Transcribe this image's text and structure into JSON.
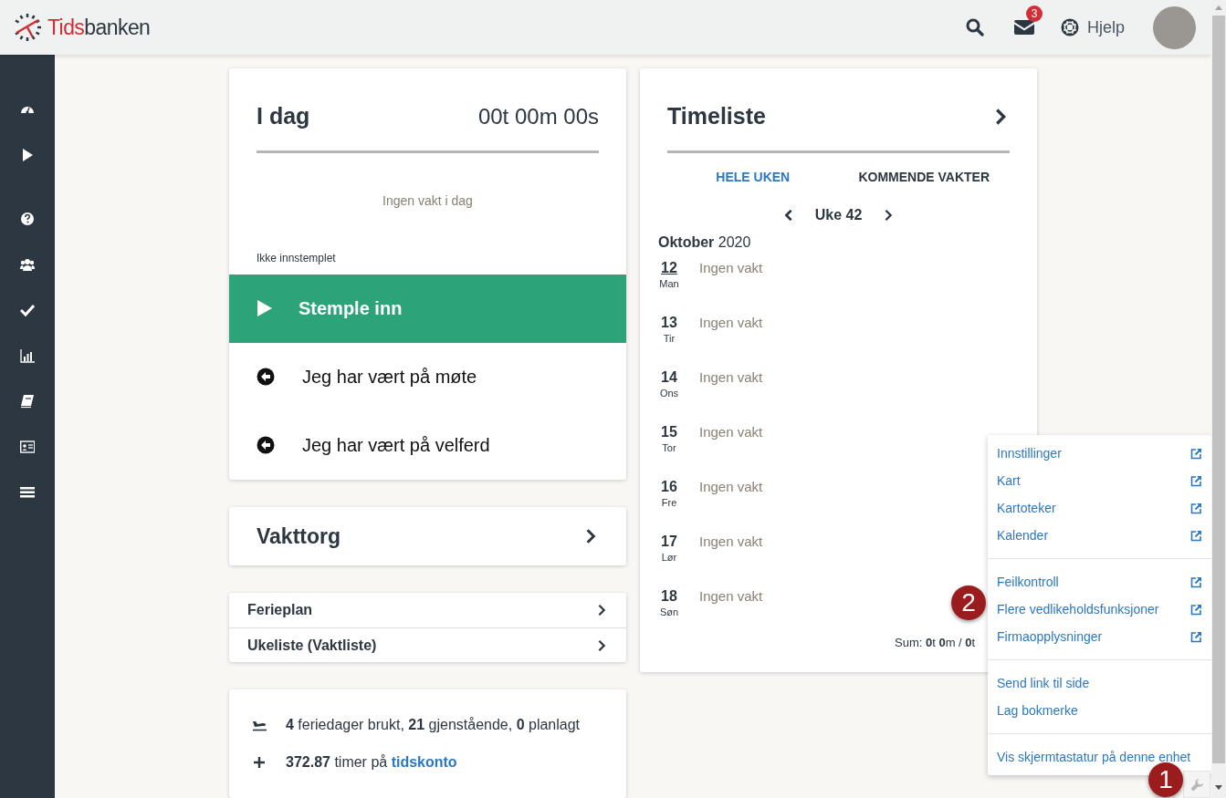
{
  "header": {
    "logo": {
      "prefix": "Tids",
      "suffix": "banken"
    },
    "messages_badge": "3",
    "help_label": "Hjelp"
  },
  "today": {
    "title": "I dag",
    "timer": "00t 00m 00s",
    "no_shift": "Ingen vakt i dag",
    "status": "Ikke innstemplet",
    "clock_in": "Stemple inn",
    "actions": [
      "Jeg har vært på møte",
      "Jeg har vært på velferd"
    ]
  },
  "shift_market": {
    "title": "Vakttorg"
  },
  "links": [
    "Ferieplan",
    "Ukeliste (Vaktliste)"
  ],
  "summary": {
    "vacation": "**4** feriedager brukt, **21** gjenstående, **0** planlagt",
    "balance": "**372.87** timer på",
    "balance_link": "tidskonto"
  },
  "timesheet": {
    "title": "Timeliste",
    "tabs": [
      {
        "label": "HELE UKEN",
        "selected": true
      },
      {
        "label": "KOMMENDE VAKTER",
        "selected": false
      }
    ],
    "week": "Uke 42",
    "month": "**Oktober** 2020",
    "days": [
      {
        "date": "12",
        "weekday": "Man",
        "text": "Ingen vakt",
        "today": true
      },
      {
        "date": "13",
        "weekday": "Tir",
        "text": "Ingen vakt",
        "today": false
      },
      {
        "date": "14",
        "weekday": "Ons",
        "text": "Ingen vakt",
        "today": false
      },
      {
        "date": "15",
        "weekday": "Tor",
        "text": "Ingen vakt",
        "today": false
      },
      {
        "date": "16",
        "weekday": "Fre",
        "text": "Ingen vakt",
        "today": false
      },
      {
        "date": "17",
        "weekday": "Lør",
        "text": "Ingen vakt",
        "today": false
      },
      {
        "date": "18",
        "weekday": "Søn",
        "text": "Ingen vakt",
        "today": false
      }
    ],
    "sum": "Sum: **0**t **0**m / **0**t"
  },
  "menu": {
    "groups": [
      [
        {
          "label": "Innstillinger",
          "external": true
        },
        {
          "label": "Kart",
          "external": true
        },
        {
          "label": "Kartoteker",
          "external": true
        },
        {
          "label": "Kalender",
          "external": true
        }
      ],
      [
        {
          "label": "Feilkontroll",
          "external": true
        },
        {
          "label": "Flere vedlikeholdsfunksjoner",
          "external": true
        },
        {
          "label": "Firmaopplysninger",
          "external": true
        }
      ],
      [
        {
          "label": "Send link til side",
          "external": false
        },
        {
          "label": "Lag bokmerke",
          "external": false
        }
      ],
      [
        {
          "label": "Vis skjermtastatur på denne enhet",
          "external": false
        }
      ]
    ]
  },
  "callouts": [
    "1",
    "2"
  ]
}
